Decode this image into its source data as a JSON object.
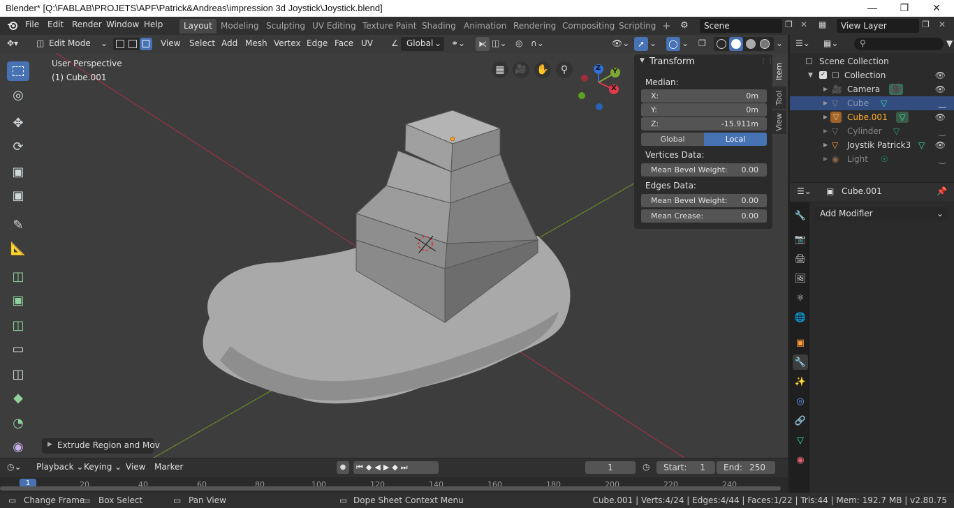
{
  "window": {
    "title": "Blender* [Q:\\FABLAB\\PROJETS\\APF\\Patrick&Andreas\\impression 3d Joystick\\Joystick.blend]",
    "minimize": "—",
    "restore": "❐",
    "close": "✕"
  },
  "menu": {
    "items": [
      "File",
      "Edit",
      "Render",
      "Window",
      "Help"
    ]
  },
  "workspaces": {
    "tabs": [
      "Layout",
      "Modeling",
      "Sculpting",
      "UV Editing",
      "Texture Paint",
      "Shading",
      "Animation",
      "Rendering",
      "Compositing",
      "Scripting"
    ],
    "active": "Layout",
    "add": "+"
  },
  "scene": {
    "label": "Scene"
  },
  "view_layer": {
    "label": "View Layer"
  },
  "viewport_header": {
    "mode": "Edit Mode",
    "menus": [
      "View",
      "Select",
      "Add",
      "Mesh",
      "Vertex",
      "Edge",
      "Face",
      "UV"
    ],
    "orientation": "Global"
  },
  "viewport": {
    "perspective": "User Perspective",
    "object": "(1) Cube.001",
    "last_operator": "Extrude Region and Mov",
    "gizmo": {
      "z": "Z",
      "y": "Y",
      "x": "X"
    }
  },
  "npanel": {
    "title": "Transform",
    "median_label": "Median:",
    "fields": [
      {
        "label": "X:",
        "value": "0m"
      },
      {
        "label": "Y:",
        "value": "0m"
      },
      {
        "label": "Z:",
        "value": "-15.911m"
      }
    ],
    "space": {
      "global": "Global",
      "local": "Local",
      "active": "Local"
    },
    "vertices_data": "Vertices Data:",
    "vertex_bevel": {
      "label": "Mean Bevel Weight:",
      "value": "0.00"
    },
    "edges_data": "Edges Data:",
    "edge_bevel": {
      "label": "Mean Bevel Weight:",
      "value": "0.00"
    },
    "edge_crease": {
      "label": "Mean Crease:",
      "value": "0.00"
    },
    "tabs": [
      "Item",
      "Tool",
      "View"
    ]
  },
  "outliner": {
    "scene_collection": "Scene Collection",
    "collection": "Collection",
    "items": [
      {
        "name": "Camera",
        "selected": false,
        "dim": false,
        "color": "#ff9b3b"
      },
      {
        "name": "Cube",
        "selected": true,
        "dim": true,
        "color": "#bbbbbb"
      },
      {
        "name": "Cube.001",
        "selected": false,
        "dim": false,
        "color": "#ffaf29"
      },
      {
        "name": "Cylinder",
        "selected": false,
        "dim": true,
        "color": "#bbbbbb"
      },
      {
        "name": "Joystik Patrick3",
        "selected": false,
        "dim": false,
        "color": "#e0e0e0"
      },
      {
        "name": "Light",
        "selected": false,
        "dim": true,
        "color": "#bbbbbb"
      }
    ]
  },
  "properties": {
    "object_name": "Cube.001",
    "add_modifier": "Add Modifier"
  },
  "timeline": {
    "menus": [
      "Playback",
      "Keying",
      "View",
      "Marker"
    ],
    "current_frame": "1",
    "start_label": "Start:",
    "start": "1",
    "end_label": "End:",
    "end": "250",
    "frame_marker": "1",
    "ticks": [
      "20",
      "40",
      "60",
      "80",
      "100",
      "120",
      "140",
      "160",
      "180",
      "200",
      "220",
      "240"
    ]
  },
  "status": {
    "left": [
      {
        "icon": "mouse-left-icon",
        "label": "Change Frame"
      },
      {
        "icon": "mouse-middle-icon",
        "label": "Box Select"
      },
      {
        "icon": "mouse-middle-icon",
        "label": "Pan View"
      },
      {
        "icon": "mouse-right-icon",
        "label": "Dope Sheet Context Menu"
      }
    ],
    "stats": "Cube.001 | Verts:4/24 | Edges:4/44 | Faces:1/22 | Tris:44 | Mem: 192.7 MB | v2.80.75"
  },
  "colors": {
    "accent": "#4772b3",
    "selected_row": "#334d80",
    "x_axis": "#e0394a",
    "y_axis": "#7fa836",
    "z_axis": "#2f6fd6"
  }
}
